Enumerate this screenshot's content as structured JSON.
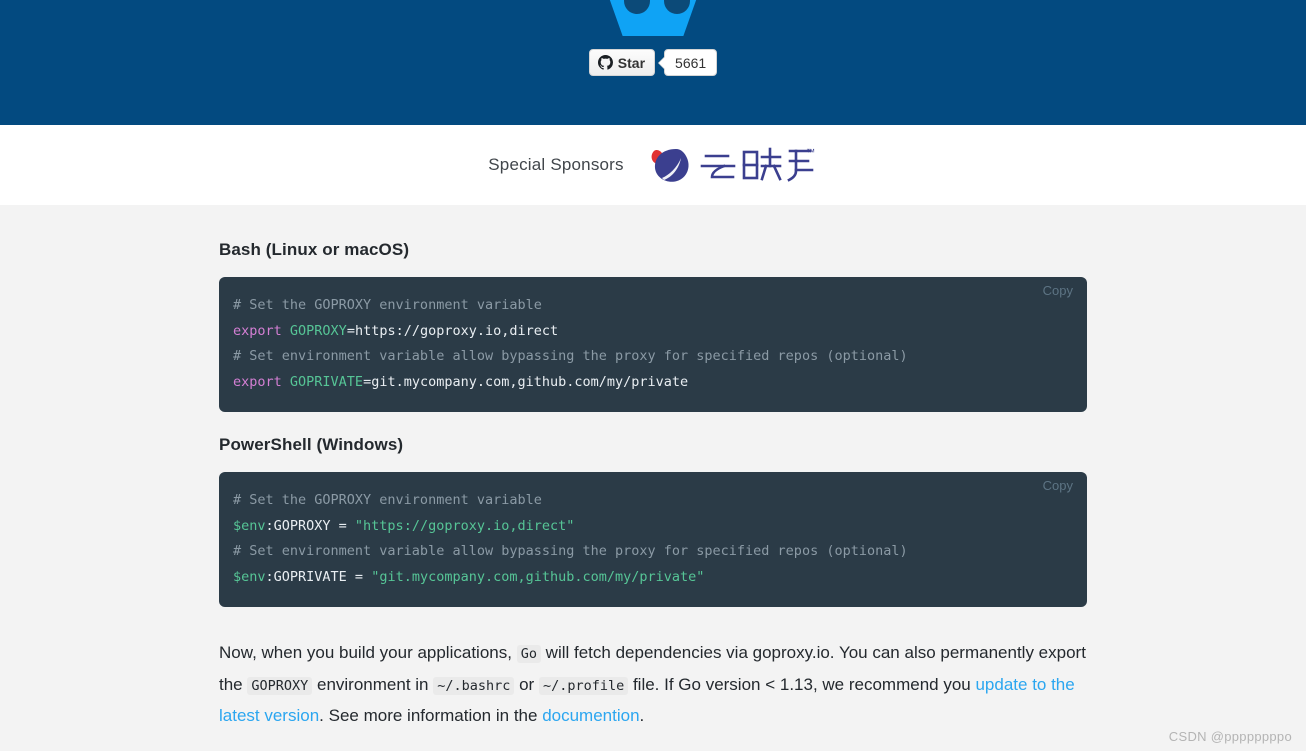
{
  "banner": {
    "github": {
      "icon": "github-octocat-icon",
      "star_label": "Star",
      "star_count": "5661"
    }
  },
  "sponsors": {
    "label": "Special Sponsors",
    "logo_name": "yunzhanghu-logo",
    "logo_text": "云账户",
    "logo_tm": "™"
  },
  "main": {
    "bash": {
      "title": "Bash (Linux or macOS)",
      "copy_label": "Copy",
      "lines": [
        {
          "parts": [
            {
              "cls": "tok-comment",
              "text": "# Set the GOPROXY environment variable"
            }
          ]
        },
        {
          "parts": [
            {
              "cls": "tok-keyword",
              "text": "export "
            },
            {
              "cls": "tok-var",
              "text": "GOPROXY"
            },
            {
              "cls": "tok-plain",
              "text": "=https://goproxy.io,direct"
            }
          ]
        },
        {
          "parts": [
            {
              "cls": "tok-comment",
              "text": "# Set environment variable allow bypassing the proxy for specified repos (optional)"
            }
          ]
        },
        {
          "parts": [
            {
              "cls": "tok-keyword",
              "text": "export "
            },
            {
              "cls": "tok-var",
              "text": "GOPRIVATE"
            },
            {
              "cls": "tok-plain",
              "text": "=git.mycompany.com,github.com/my/private"
            }
          ]
        }
      ]
    },
    "powershell": {
      "title": "PowerShell (Windows)",
      "copy_label": "Copy",
      "lines": [
        {
          "parts": [
            {
              "cls": "tok-comment",
              "text": "# Set the GOPROXY environment variable"
            }
          ]
        },
        {
          "parts": [
            {
              "cls": "tok-var",
              "text": "$env"
            },
            {
              "cls": "tok-plain",
              "text": ":GOPROXY = "
            },
            {
              "cls": "tok-string",
              "text": "\"https://goproxy.io,direct\""
            }
          ]
        },
        {
          "parts": [
            {
              "cls": "tok-comment",
              "text": "# Set environment variable allow bypassing the proxy for specified repos (optional)"
            }
          ]
        },
        {
          "parts": [
            {
              "cls": "tok-var",
              "text": "$env"
            },
            {
              "cls": "tok-plain",
              "text": ":GOPRIVATE = "
            },
            {
              "cls": "tok-string",
              "text": "\"git.mycompany.com,github.com/my/private\""
            }
          ]
        }
      ]
    },
    "paragraph": {
      "t1": "Now, when you build your applications, ",
      "code1": "Go",
      "t2": " will fetch dependencies via goproxy.io. You can also permanently export the ",
      "code2": "GOPROXY",
      "t3": " environment in ",
      "code3": "~/.bashrc",
      "t4": " or ",
      "code4": "~/.profile",
      "t5": " file. If Go version < 1.13, we recommend you ",
      "link1": "update to the latest version",
      "t6": ". See more information in the ",
      "link2": "documention",
      "t7": "."
    }
  },
  "watermark": "CSDN @ppppppppo",
  "colors": {
    "banner_bg": "#034a80",
    "gopher_blue": "#0fa3f5",
    "content_bg": "#f3f3f3",
    "code_bg": "#2b3b47",
    "link": "#2ba6f0",
    "sponsor_red": "#e03131",
    "sponsor_navy": "#3b3f8f"
  }
}
